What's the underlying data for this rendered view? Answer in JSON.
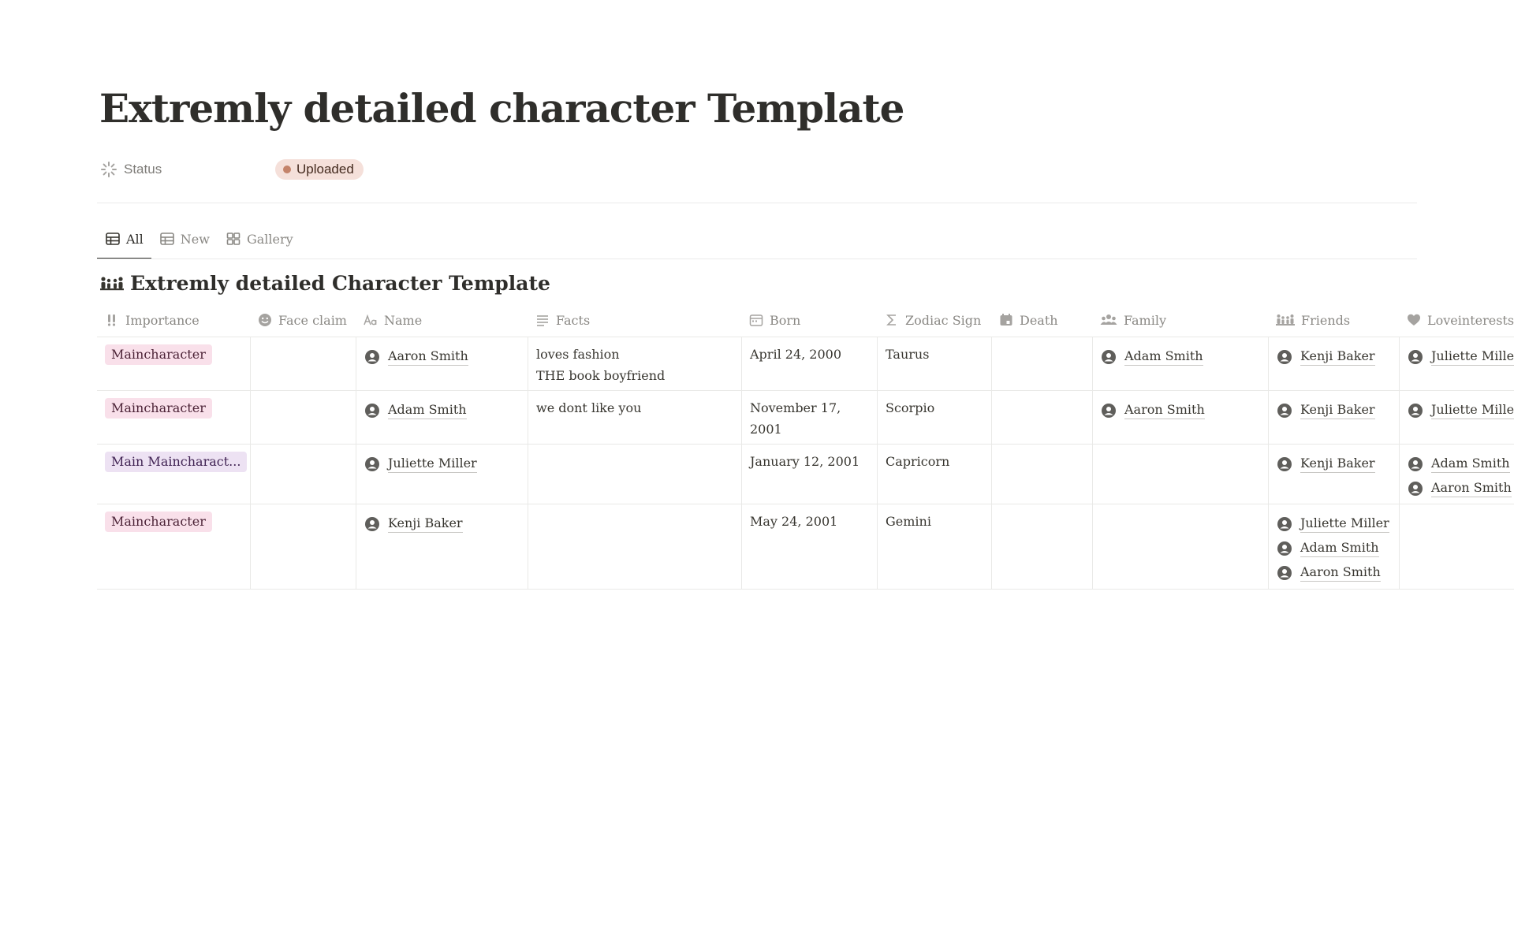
{
  "page": {
    "title": "Extremly detailed character Template",
    "status_label": "Status",
    "status_value": "Uploaded"
  },
  "tabs": [
    {
      "label": "All",
      "icon": "table-icon",
      "active": true
    },
    {
      "label": "New",
      "icon": "table-icon",
      "active": false
    },
    {
      "label": "Gallery",
      "icon": "gallery-icon",
      "active": false
    }
  ],
  "database": {
    "title": "Extremly detailed Character Template",
    "icon": "family-icon"
  },
  "columns": [
    {
      "label": "Importance",
      "icon": "exclamation-icon"
    },
    {
      "label": "Face claim",
      "icon": "smiley-icon"
    },
    {
      "label": "Name",
      "icon": "text-aa-icon"
    },
    {
      "label": "Facts",
      "icon": "lines-icon"
    },
    {
      "label": "Born",
      "icon": "calendar-icon"
    },
    {
      "label": "Zodiac Sign",
      "icon": "sigma-icon"
    },
    {
      "label": "Death",
      "icon": "calendar-filled-icon"
    },
    {
      "label": "Family",
      "icon": "people-icon"
    },
    {
      "label": "Friends",
      "icon": "family-icon"
    },
    {
      "label": "Loveinterests",
      "icon": "heart-icon"
    }
  ],
  "rows": [
    {
      "importance": "Maincharacter",
      "importance_color": "#f9e0ea",
      "name": "Aaron Smith",
      "facts": [
        "loves fashion",
        "THE book boyfriend"
      ],
      "born": "April 24, 2000",
      "zodiac": "Taurus",
      "family": [
        "Adam Smith"
      ],
      "friends": [
        "Kenji Baker"
      ],
      "loveinterests": [
        "Juliette Miller"
      ]
    },
    {
      "importance": "Maincharacter",
      "importance_color": "#f9e0ea",
      "name": "Adam Smith",
      "facts": [
        "we dont like you"
      ],
      "born_lines": [
        "November 17,",
        "2001"
      ],
      "zodiac": "Scorpio",
      "family": [
        "Aaron Smith"
      ],
      "friends": [
        "Kenji Baker"
      ],
      "loveinterests": [
        "Juliette Miller"
      ]
    },
    {
      "importance": "Main Maincharact...",
      "importance_color": "#ede2f3",
      "name": "Juliette Miller",
      "born": "January 12, 2001",
      "zodiac": "Capricorn",
      "friends": [
        "Kenji Baker"
      ],
      "loveinterests": [
        "Adam Smith",
        "Aaron Smith"
      ]
    },
    {
      "importance": "Maincharacter",
      "importance_color": "#f9e0ea",
      "name": "Kenji Baker",
      "born": "May 24, 2001",
      "zodiac": "Gemini",
      "friends": [
        "Juliette Miller",
        "Adam Smith",
        "Aaron Smith"
      ]
    }
  ]
}
